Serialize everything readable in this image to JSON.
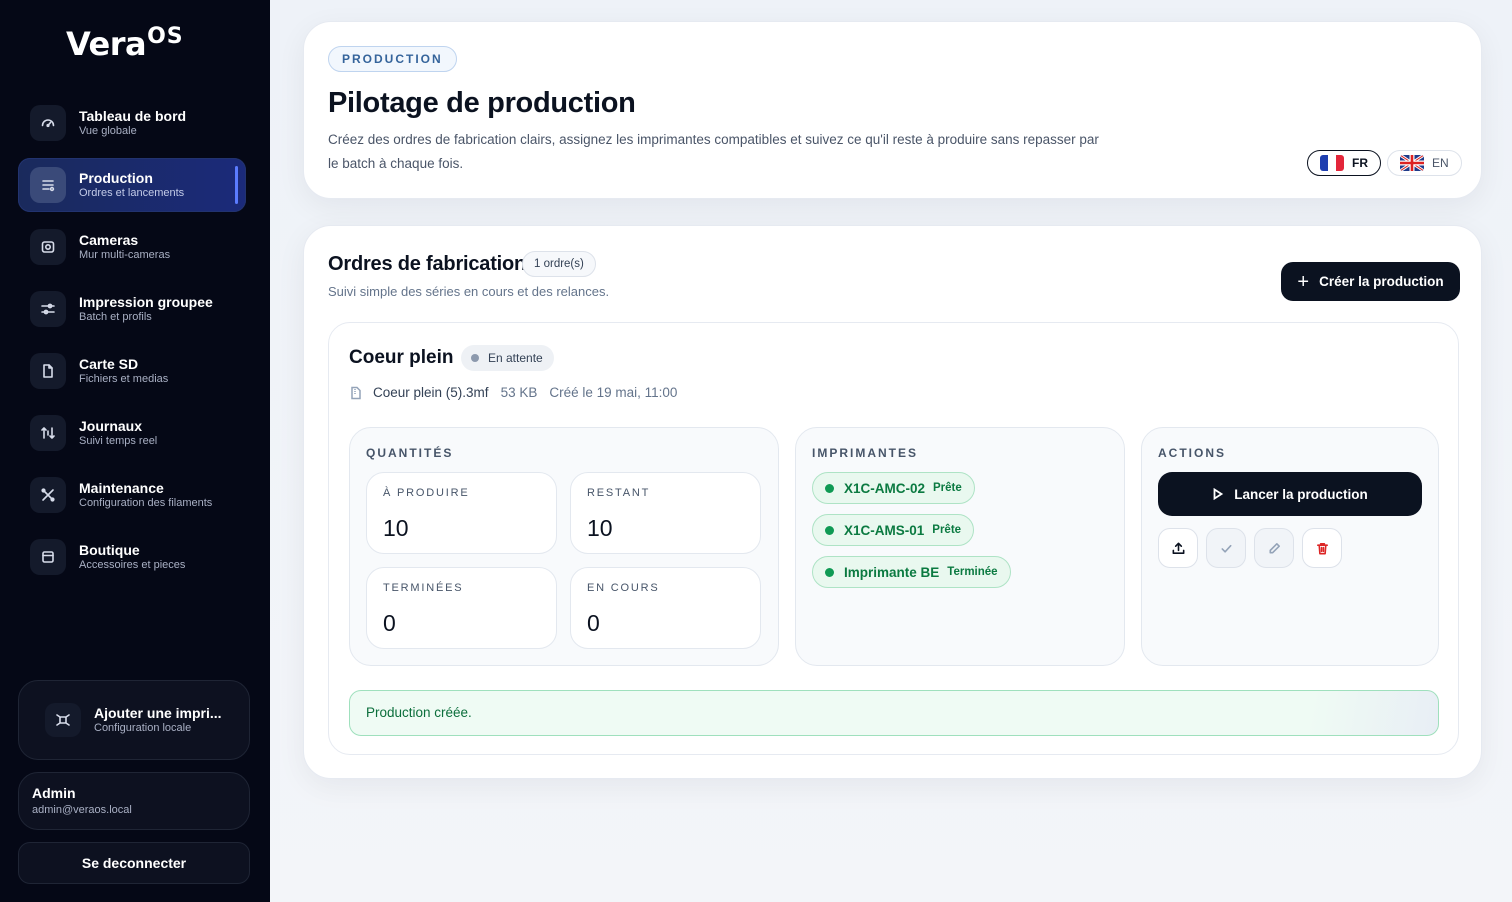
{
  "app": {
    "logo_main": "Vera",
    "logo_sup": "OS"
  },
  "sidebar": {
    "items": [
      {
        "label": "Tableau de bord",
        "sub": "Vue globale",
        "icon": "dashboard-icon"
      },
      {
        "label": "Production",
        "sub": "Ordres et lancements",
        "icon": "list-icon",
        "active": true
      },
      {
        "label": "Cameras",
        "sub": "Mur multi-cameras",
        "icon": "camera-icon"
      },
      {
        "label": "Impression groupee",
        "sub": "Batch et profils",
        "icon": "sliders-icon"
      },
      {
        "label": "Carte SD",
        "sub": "Fichiers et medias",
        "icon": "file-icon"
      },
      {
        "label": "Journaux",
        "sub": "Suivi temps reel",
        "icon": "arrows-icon"
      },
      {
        "label": "Maintenance",
        "sub": "Configuration des filaments",
        "icon": "tools-icon"
      },
      {
        "label": "Boutique",
        "sub": "Accessoires et pieces",
        "icon": "shop-icon"
      }
    ],
    "add_printer": {
      "label": "Ajouter une impri...",
      "sub": "Configuration locale"
    },
    "account": {
      "name": "Admin",
      "email": "admin@veraos.local"
    },
    "logout_label": "Se deconnecter"
  },
  "header": {
    "tag": "PRODUCTION",
    "title": "Pilotage de production",
    "description": "Créez des ordres de fabrication clairs, assignez les imprimantes compatibles et suivez ce qu'il reste à produire sans repasser par le batch à chaque fois.",
    "languages": [
      {
        "code": "FR",
        "active": true
      },
      {
        "code": "EN",
        "active": false
      }
    ]
  },
  "orders": {
    "title": "Ordres de fabrication",
    "count": "1 ordre(s)",
    "subtitle": "Suivi simple des séries en cours et des relances.",
    "create_label": "Créer la production",
    "order": {
      "name": "Coeur plein",
      "status": "En attente",
      "file": "Coeur plein (5).3mf",
      "size": "53 KB",
      "created": "Créé le 19 mai, 11:00",
      "quantities": {
        "title": "QUANTITÉS",
        "to_produce": {
          "label": "À PRODUIRE",
          "value": "10"
        },
        "remaining": {
          "label": "RESTANT",
          "value": "10"
        },
        "done": {
          "label": "TERMINÉES",
          "value": "0"
        },
        "in_progress": {
          "label": "EN COURS",
          "value": "0"
        }
      },
      "printers": {
        "title": "IMPRIMANTES",
        "items": [
          {
            "name": "X1C-AMC-02",
            "state": "Prête"
          },
          {
            "name": "X1C-AMS-01",
            "state": "Prête"
          },
          {
            "name": "Imprimante BE",
            "state": "Terminée"
          }
        ]
      },
      "actions": {
        "title": "ACTIONS",
        "launch_label": "Lancer la production",
        "buttons": [
          "upload-icon",
          "check-icon",
          "edit-icon",
          "delete-icon"
        ]
      }
    },
    "toast": "Production créée."
  },
  "colors": {
    "accent_dark": "#0b1220",
    "success": "#0f9a54",
    "danger": "#dc2626",
    "sidebar_bg": "#050816"
  }
}
